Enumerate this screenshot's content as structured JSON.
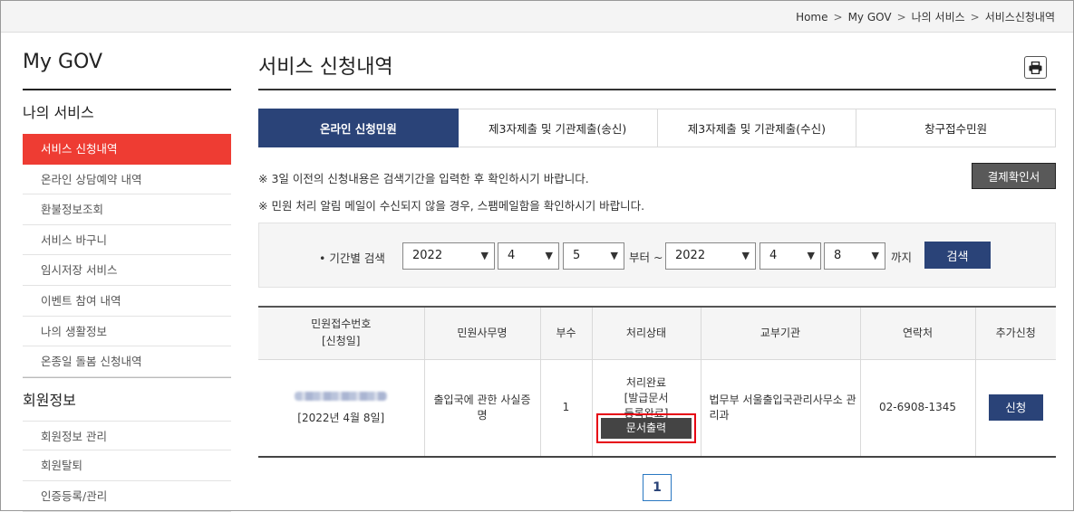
{
  "breadcrumb": [
    "Home",
    "My GOV",
    "나의 서비스",
    "서비스신청내역"
  ],
  "sidebar": {
    "title": "My GOV",
    "section1": "나의 서비스",
    "items1": [
      "서비스 신청내역",
      "온라인 상담예약 내역",
      "환불정보조회",
      "서비스 바구니",
      "임시저장 서비스",
      "이벤트 참여 내역",
      "나의 생활정보",
      "온종일 돌봄 신청내역"
    ],
    "section2": "회원정보",
    "items2": [
      "회원정보 관리",
      "회원탈퇴",
      "인증등록/관리"
    ]
  },
  "main": {
    "title": "서비스 신청내역",
    "print_icon": "printer-icon",
    "tabs": [
      "온라인 신청민원",
      "제3자제출 및 기관제출(송신)",
      "제3자제출 및 기관제출(수신)",
      "창구접수민원"
    ],
    "notice1": "※ 3일 이전의 신청내용은 검색기간을 입력한 후 확인하시기 바랍니다.",
    "notice2": "※ 민원 처리 알림 메일이 수신되지 않을 경우, 스팸메일함을 확인하시기 바랍니다.",
    "confirm_button": "결제확인서"
  },
  "search": {
    "label": "• 기간별 검색",
    "from_year": "2022",
    "from_month": "4",
    "from_day": "5",
    "from_word": "부터 ~",
    "to_year": "2022",
    "to_month": "4",
    "to_day": "8",
    "to_word": "까지",
    "button": "검색"
  },
  "table": {
    "headers": [
      "민원접수번호\n[신청일]",
      "민원사무명",
      "부수",
      "처리상태",
      "교부기관",
      "연락처",
      "추가신청"
    ],
    "header_h0_line1": "민원접수번호",
    "header_h0_line2": "[신청일]",
    "row": {
      "date": "[2022년 4월 8일]",
      "name": "출입국에 관한 사실증명",
      "copies": "1",
      "status_line1": "처리완료",
      "status_line2": "[발급문서",
      "status_line3": "등록완료]",
      "print_button": "문서출력",
      "agency": "법무부 서울출입국관리사무소 관리과",
      "contact": "02-6908-1345",
      "apply_button": "신청"
    }
  },
  "pager": {
    "current": "1"
  },
  "colors": {
    "accent_red": "#ee3c33",
    "navy": "#2a4378",
    "highlight": "#e60012"
  }
}
